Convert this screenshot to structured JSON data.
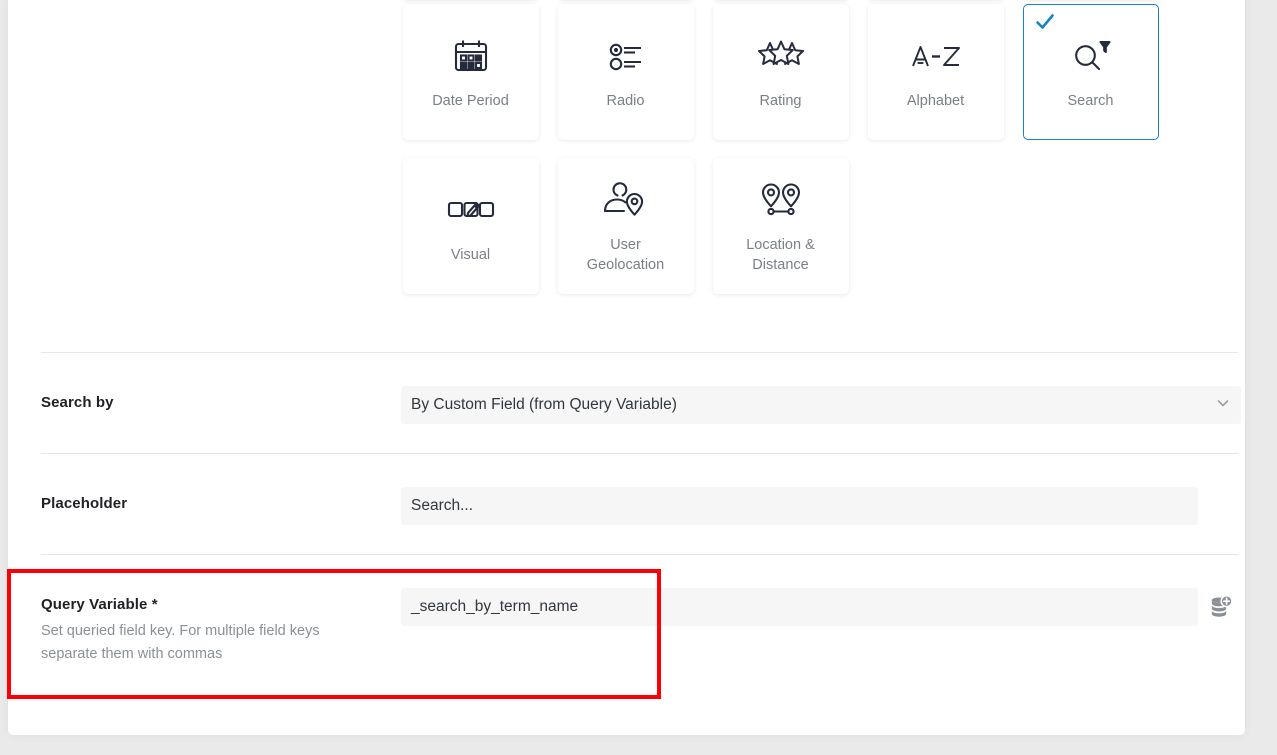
{
  "panel": {
    "cards_rows": [
      {
        "clipped": true,
        "items": [
          {
            "label": "",
            "icon": "clipped-card-icon",
            "selected": false
          },
          {
            "label": "",
            "icon": "clipped-card-icon",
            "selected": false
          },
          {
            "label": "",
            "icon": "clipped-card-icon",
            "selected": false
          },
          {
            "label": "",
            "icon": "clipped-card-icon",
            "selected": false
          },
          {
            "label": "",
            "icon": "clipped-card-icon",
            "selected": false
          }
        ]
      },
      {
        "clipped": false,
        "items": [
          {
            "label": "Date Period",
            "icon": "calendar-icon",
            "selected": false
          },
          {
            "label": "Radio",
            "icon": "radio-list-icon",
            "selected": false
          },
          {
            "label": "Rating",
            "icon": "stars-icon",
            "selected": false
          },
          {
            "label": "Alphabet",
            "icon": "a-to-z-icon",
            "selected": false
          },
          {
            "label": "Search",
            "icon": "search-filter-icon",
            "selected": true
          }
        ]
      },
      {
        "clipped": false,
        "items": [
          {
            "label": "Visual",
            "icon": "visual-swatches-icon",
            "selected": false
          },
          {
            "label": "User Geolocation",
            "icon": "user-geolocation-icon",
            "selected": false
          },
          {
            "label": "Location & Distance",
            "icon": "location-distance-icon",
            "selected": false
          }
        ]
      }
    ],
    "fields": {
      "search_by": {
        "label": "Search by",
        "value": "By Custom Field (from Query Variable)",
        "chevron": "⌄"
      },
      "placeholder_field": {
        "label": "Placeholder",
        "value": "Search..."
      },
      "query_variable": {
        "label": "Query Variable *",
        "help": "Set queried field key. For multiple field keys separate them with commas",
        "value": "_search_by_term_name",
        "dynamic_tag_icon": "database-add-icon"
      }
    }
  },
  "annotation": {
    "highlight_color": "#fb0007"
  }
}
